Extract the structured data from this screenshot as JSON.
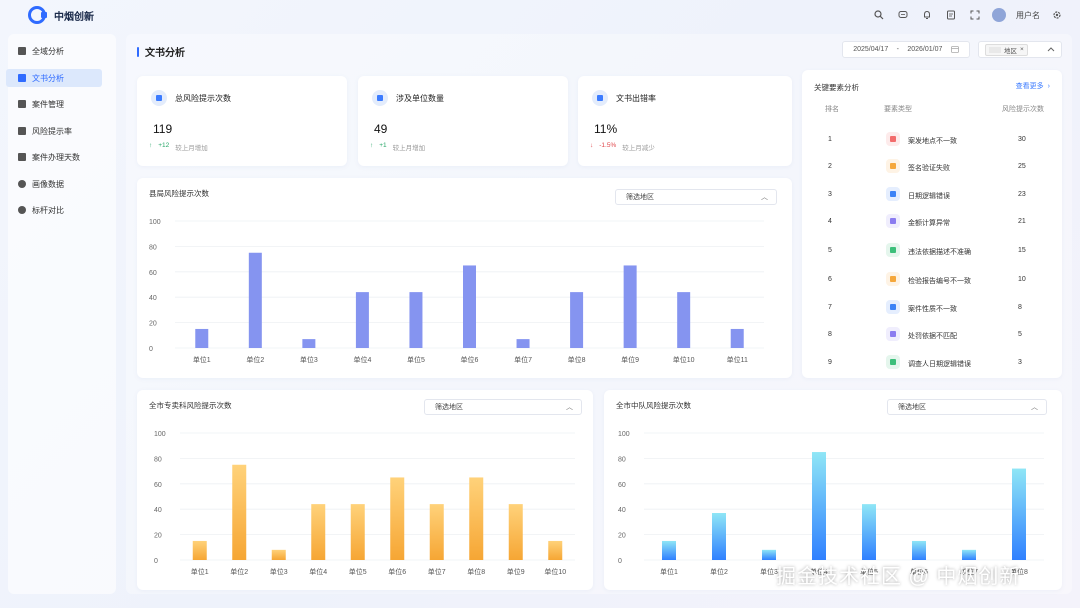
{
  "app": {
    "brand": "中烟创新",
    "user_name": "用户名"
  },
  "sidebar": {
    "items": [
      {
        "label": "全域分析",
        "active": false
      },
      {
        "label": "文书分析",
        "active": true
      },
      {
        "label": "案件管理",
        "active": false
      },
      {
        "label": "风险提示率",
        "active": false
      },
      {
        "label": "案件办理天数",
        "active": false
      },
      {
        "label": "画像数据",
        "active": false
      },
      {
        "label": "标杆对比",
        "active": false
      }
    ]
  },
  "page": {
    "title": "文书分析",
    "date_start": "2025/04/17",
    "date_sep": "-",
    "date_end": "2026/01/07",
    "region_tag": "地区",
    "region_tag_close": "×"
  },
  "kpis": [
    {
      "title": "总风险提示次数",
      "value": "119",
      "change": "+12",
      "change_dir": "up",
      "change_label": "较上月增加"
    },
    {
      "title": "涉及单位数量",
      "value": "49",
      "change": "+1",
      "change_dir": "up",
      "change_label": "较上月增加"
    },
    {
      "title": "文书出错率",
      "value": "11%",
      "change": "-1.5%",
      "change_dir": "down",
      "change_label": "较上月减少"
    }
  ],
  "key_elements": {
    "title": "关键要素分析",
    "more": "查看更多",
    "headers": {
      "rank": "排名",
      "type": "要素类型",
      "count": "风险提示次数"
    },
    "rows": [
      {
        "rank": "1",
        "type": "案发地点不一致",
        "count": "30",
        "color": "#f26b6b"
      },
      {
        "rank": "2",
        "type": "签名验证失败",
        "count": "25",
        "color": "#f5a73b"
      },
      {
        "rank": "3",
        "type": "日期逻辑错误",
        "count": "23",
        "color": "#3b82f6"
      },
      {
        "rank": "4",
        "type": "金额计算异常",
        "count": "21",
        "color": "#8b7cf0"
      },
      {
        "rank": "5",
        "type": "违法依据描述不准确",
        "count": "15",
        "color": "#3cbf7a"
      },
      {
        "rank": "6",
        "type": "检验报告编号不一致",
        "count": "10",
        "color": "#f5a73b"
      },
      {
        "rank": "7",
        "type": "案件性质不一致",
        "count": "8",
        "color": "#3b82f6"
      },
      {
        "rank": "8",
        "type": "处罚依据不匹配",
        "count": "5",
        "color": "#8b7cf0"
      },
      {
        "rank": "9",
        "type": "调查人日期逻辑错误",
        "count": "3",
        "color": "#3cbf7a"
      }
    ]
  },
  "charts": {
    "county": {
      "title": "县局风险提示次数",
      "filter": "筛选地区",
      "colors": {
        "bar": "#8594f0"
      }
    },
    "specialist": {
      "title": "全市专卖科风险提示次数",
      "filter": "筛选地区",
      "colors": {
        "top": "#ffd27a",
        "bottom": "#f6a634"
      }
    },
    "brigade": {
      "title": "全市中队风险提示次数",
      "filter": "筛选地区",
      "colors": {
        "top": "#8fe6f6",
        "bottom": "#2f80ff"
      }
    }
  },
  "chart_data": [
    {
      "type": "bar",
      "title": "县局风险提示次数",
      "categories": [
        "单位1",
        "单位2",
        "单位3",
        "单位4",
        "单位5",
        "单位6",
        "单位7",
        "单位8",
        "单位9",
        "单位10",
        "单位11"
      ],
      "values": [
        15,
        75,
        7,
        44,
        44,
        65,
        7,
        44,
        65,
        44,
        15
      ],
      "yticks": [
        0,
        20,
        40,
        60,
        80,
        100
      ],
      "ylim": [
        0,
        100
      ],
      "grid": true
    },
    {
      "type": "bar",
      "title": "全市专卖科风险提示次数",
      "categories": [
        "单位1",
        "单位2",
        "单位3",
        "单位4",
        "单位5",
        "单位6",
        "单位7",
        "单位8",
        "单位9",
        "单位10"
      ],
      "values": [
        15,
        75,
        8,
        44,
        44,
        65,
        44,
        65,
        44,
        15
      ],
      "yticks": [
        0,
        20,
        40,
        60,
        80,
        100
      ],
      "ylim": [
        0,
        100
      ],
      "grid": true
    },
    {
      "type": "bar",
      "title": "全市中队风险提示次数",
      "categories": [
        "单位1",
        "单位2",
        "单位3",
        "单位4",
        "单位5",
        "单位6",
        "单位7",
        "单位8"
      ],
      "values": [
        15,
        37,
        8,
        85,
        44,
        15,
        8,
        72
      ],
      "yticks": [
        0,
        20,
        40,
        60,
        80,
        100
      ],
      "ylim": [
        0,
        100
      ],
      "grid": true
    }
  ],
  "watermark": "掘金技术社区 @ 中烟创新"
}
